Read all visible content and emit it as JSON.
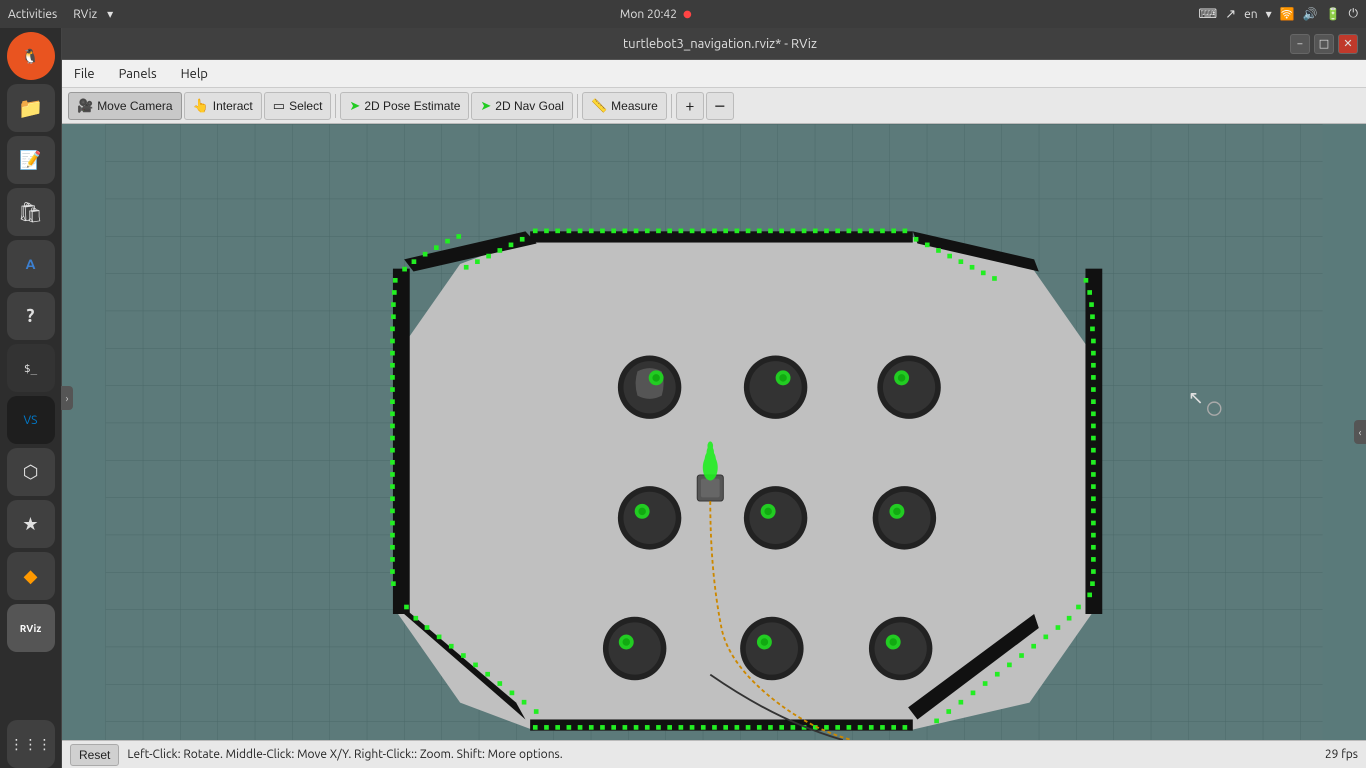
{
  "system_bar": {
    "activities": "Activities",
    "app_name": "RViz",
    "app_dropdown": "▾",
    "time": "Mon 20:42",
    "recording_dot": "●",
    "keyboard_icon": "⌨",
    "network_icon": "↗",
    "lang": "en",
    "lang_arrow": "▾",
    "wifi_icon": "▲",
    "volume_icon": "🔊",
    "battery_icon": "⚡",
    "power_icon": "⏻"
  },
  "title_bar": {
    "title": "turtlebot3_navigation.rviz* - RViz",
    "minimize": "−",
    "maximize": "□",
    "close": "✕"
  },
  "menu": {
    "file": "File",
    "panels": "Panels",
    "help": "Help"
  },
  "toolbar": {
    "move_camera": "Move Camera",
    "interact": "Interact",
    "select": "Select",
    "pose_estimate": "2D Pose Estimate",
    "nav_goal": "2D Nav Goal",
    "measure": "Measure",
    "add_icon": "+",
    "minus_icon": "−"
  },
  "status_bar": {
    "reset": "Reset",
    "hint": "Left-Click: Rotate. Middle-Click: Move X/Y. Right-Click:: Zoom. Shift: More options.",
    "fps": "29 fps"
  },
  "dock": {
    "items": [
      {
        "icon": "🐧",
        "label": "Ubuntu"
      },
      {
        "icon": "📁",
        "label": "Files"
      },
      {
        "icon": "📝",
        "label": "Text Editor"
      },
      {
        "icon": "🛍",
        "label": "App Store"
      },
      {
        "icon": "A",
        "label": "LibreOffice Writer"
      },
      {
        "icon": "?",
        "label": "Help"
      },
      {
        "icon": ">_",
        "label": "Terminal"
      },
      {
        "icon": "VS",
        "label": "VSCode"
      },
      {
        "icon": "⬡",
        "label": "ROS"
      },
      {
        "icon": "★",
        "label": "Starred"
      },
      {
        "icon": "◆",
        "label": "App"
      },
      {
        "icon": "RViz",
        "label": "RViz"
      },
      {
        "icon": "⋮⋮⋮",
        "label": "All Apps"
      }
    ]
  },
  "viewport": {
    "bg_color": "#5a7a7a",
    "grid_color": "#4a6a6a"
  }
}
